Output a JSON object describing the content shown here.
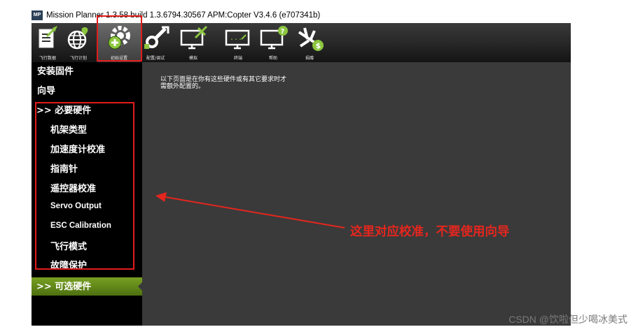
{
  "window": {
    "title": "Mission Planner 1.3.58 build 1.3.6794.30567 APM:Copter V3.4.6 (e707341b)",
    "app_icon_text": "MP"
  },
  "toolbar": {
    "items": [
      {
        "icon": "flight-data-icon",
        "label": "飞行数据"
      },
      {
        "icon": "flight-plan-icon",
        "label": "飞行计划"
      },
      {
        "icon": "initial-setup-icon",
        "label": "初始设置"
      },
      {
        "icon": "config-tuning-icon",
        "label": "配置/调试"
      },
      {
        "icon": "simulation-icon",
        "label": "模拟"
      },
      {
        "icon": "terminal-icon",
        "label": "终端"
      },
      {
        "icon": "help-icon",
        "label": "帮助"
      },
      {
        "icon": "donate-icon",
        "label": "捐赠"
      }
    ]
  },
  "sidebar": {
    "items": [
      {
        "label": "安装固件"
      },
      {
        "label": "向导"
      },
      {
        "label": ">> 必要硬件"
      },
      {
        "label": "机架类型"
      },
      {
        "label": "加速度计校准"
      },
      {
        "label": "指南针"
      },
      {
        "label": "遥控器校准"
      },
      {
        "label": "Servo Output"
      },
      {
        "label": "ESC Calibration"
      },
      {
        "label": "飞行模式"
      },
      {
        "label": "故障保护"
      },
      {
        "label": ">> 可选硬件"
      }
    ]
  },
  "main": {
    "info_line1": "以下页面是在你有这些硬件或有其它要求时才",
    "info_line2": "需额外配置的。"
  },
  "annotation": {
    "text": "这里对应校准，不要使用向导",
    "color": "#e5261e"
  },
  "watermark": "CSDN @饮啦但少喝冰美式"
}
